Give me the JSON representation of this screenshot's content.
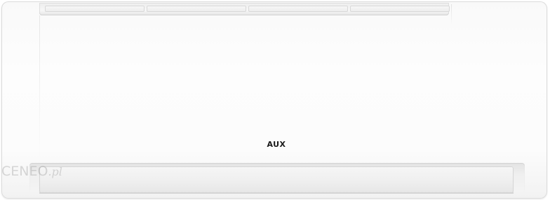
{
  "product": {
    "brand_logo": "AUX",
    "body_color": "#fcfcfc",
    "logo_color": "#1a1a1a"
  },
  "watermark": {
    "text": "CENEO",
    "suffix": ".pl"
  }
}
